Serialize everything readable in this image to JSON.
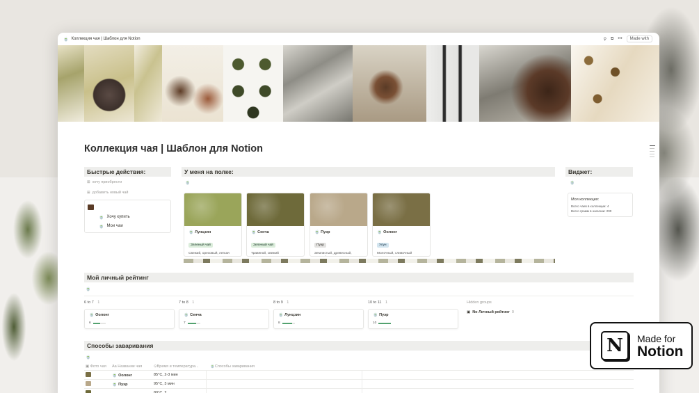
{
  "window": {
    "title": "Коллекция чая | Шаблон для Notion",
    "made_with": "Made with"
  },
  "page_title": "Коллекция чая | Шаблон для Notion",
  "quick": {
    "heading": "Быстрые действия:",
    "btn_want": "хочу приобрести",
    "btn_add": "добавить новый чай",
    "links": [
      "Хочу купить",
      "Мои чаи"
    ]
  },
  "shelf": {
    "heading": "У меня на полке:",
    "cards": [
      {
        "name": "Лунцзин",
        "tag": "Зеленый чай",
        "desc": "Свежий, ореховый, легкая сладость",
        "tag_color": "#dbeddb",
        "tag_text": "#1c3829",
        "img": "#9aa55a"
      },
      {
        "name": "Сенча",
        "tag": "Зеленый чай",
        "desc": "Травяной, свежий",
        "tag_color": "#dbeddb",
        "tag_text": "#1c3829",
        "img": "#6e6a3a"
      },
      {
        "name": "Пуэр",
        "tag": "Пуэр",
        "desc": "Землистый, древесный, терпкий",
        "tag_color": "#e3e2e0",
        "tag_text": "#32302c",
        "img": "#b9a88a"
      },
      {
        "name": "Оолонг",
        "tag": "Улун",
        "desc": "Молочный, сливочный",
        "tag_color": "#d3e5ef",
        "tag_text": "#183347",
        "img": "#7a6f45"
      }
    ]
  },
  "widget": {
    "heading": "Виджет:",
    "title": "Моя коллекция:",
    "line1": "Всего чаев в коллекции: 4",
    "line2": "Всего грамм в наличии: 200"
  },
  "rating": {
    "heading": "Мой личный рейтинг",
    "columns": [
      {
        "label": "6 to 7",
        "count": "1",
        "name": "Оолонг",
        "score": "6",
        "pct": 0.6
      },
      {
        "label": "7 to 8",
        "count": "1",
        "name": "Сенча",
        "score": "7",
        "pct": 0.7
      },
      {
        "label": "8 to 9",
        "count": "1",
        "name": "Лунцзин",
        "score": "8",
        "pct": 0.8
      },
      {
        "label": "10 to 11",
        "count": "1",
        "name": "Пуэр",
        "score": "10",
        "pct": 1.0
      }
    ],
    "hidden_label": "Hidden groups",
    "hidden_item": "No Личный рейтинг",
    "hidden_count": "0"
  },
  "brew": {
    "heading": "Способы заваривания",
    "headers": [
      "Фото чая",
      "Название чая",
      "Время и температура...",
      "Способы заваривания"
    ],
    "rows": [
      {
        "name": "Оолонг",
        "time": "85°C, 2-3 мин",
        "thumb": "#7a6f45"
      },
      {
        "name": "Пуэр",
        "time": "95°C, 3 мин",
        "thumb": "#b9a88a"
      },
      {
        "name": "",
        "time": "80°C, 2",
        "thumb": "#6e6a3a"
      }
    ]
  },
  "badge": {
    "line1": "Made for",
    "line2": "Notion",
    "logo": "N"
  }
}
